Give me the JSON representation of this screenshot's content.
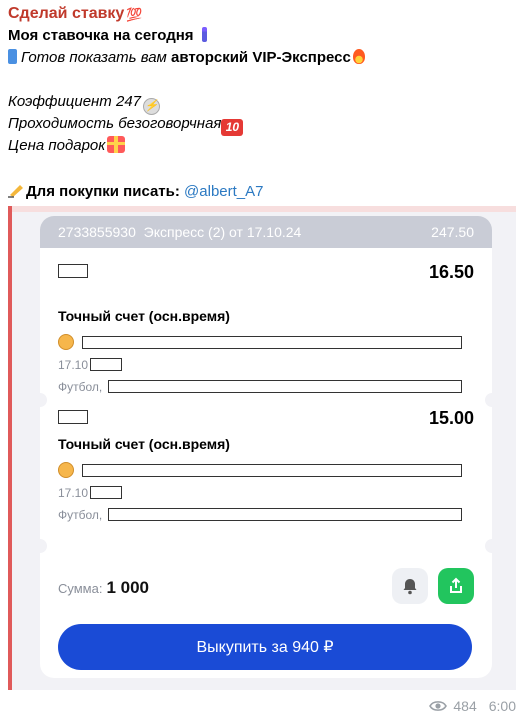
{
  "message": {
    "sender": "Сделай ставку",
    "sender_emoji": "💯",
    "line1": "Моя ставочка на сегодня",
    "line2_italic": "Готов показать вам",
    "line2_bold": "авторский VIP-Экспресс",
    "coef": "Коэффициент 247",
    "pass": "Проходимость безоговорчная",
    "price": "Цена подарок",
    "contact_label": "Для покупки писать:",
    "contact_link": "@albert_A7"
  },
  "ticket": {
    "id": "2733855930",
    "title": "Экспресс (2) от 17.10.24",
    "total_odds": "247.50",
    "bets": [
      {
        "odds": "16.50",
        "market": "Точный счет (осн.время)",
        "date": "17.10",
        "sport": "Футбол,"
      },
      {
        "odds": "15.00",
        "market": "Точный счет (осн.время)",
        "date": "17.10",
        "sport": "Футбол,"
      }
    ],
    "sum_label": "Сумма:",
    "sum_value": "1 000",
    "buy_label": "Выкупить за 940 ₽"
  },
  "footer": {
    "views": "484",
    "time": "6:00"
  },
  "icons": {
    "bell": "bell-icon",
    "share": "share-icon",
    "eye": "eye-icon"
  },
  "colors": {
    "sender": "#c0392b",
    "link": "#2b79c2",
    "buy": "#1a4bd6",
    "share": "#22c55e"
  }
}
